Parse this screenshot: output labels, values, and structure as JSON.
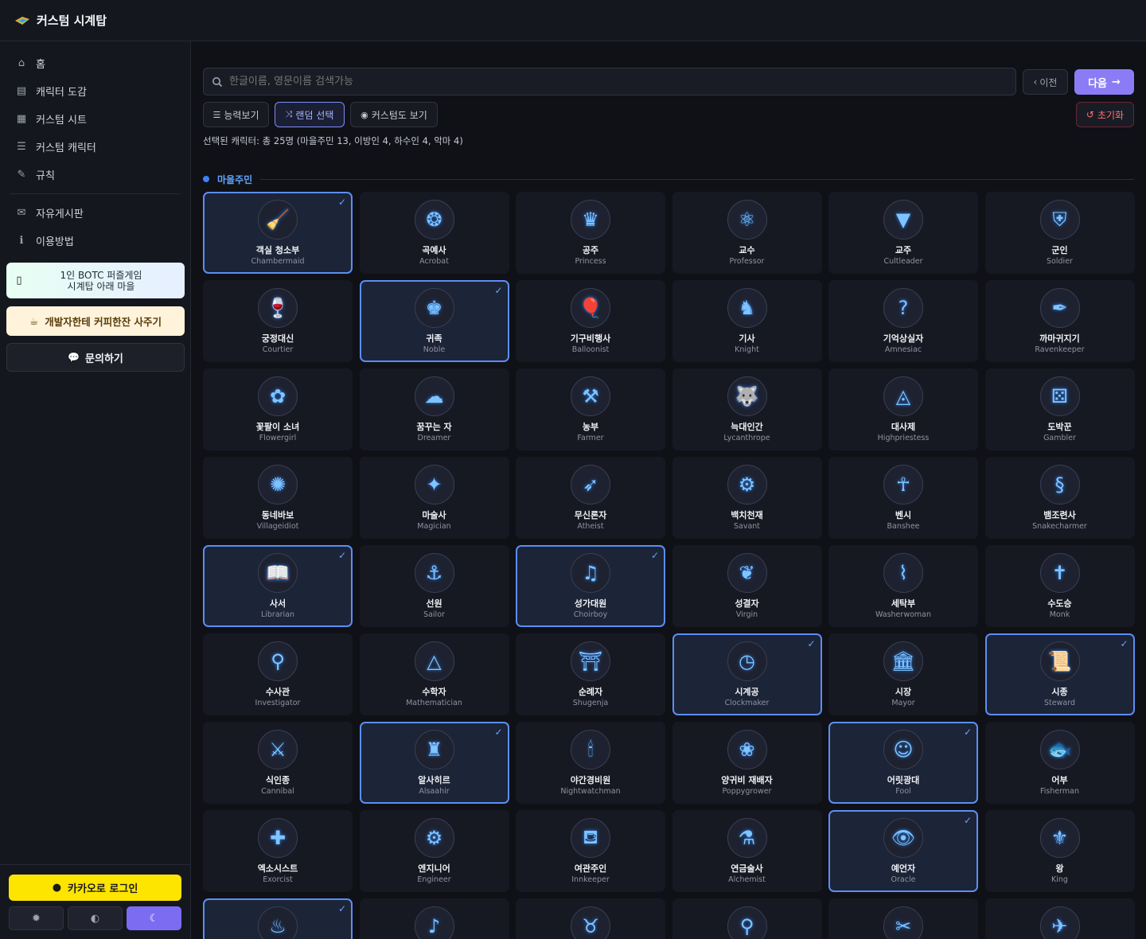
{
  "app": {
    "title": "커스텀 시계탑"
  },
  "nav": [
    {
      "label": "홈",
      "icon": "home-icon",
      "glyph": "⌂"
    },
    {
      "label": "캐릭터 도감",
      "icon": "book-icon",
      "glyph": "▤"
    },
    {
      "label": "커스텀 시트",
      "icon": "file-icon",
      "glyph": "▦"
    },
    {
      "label": "커스텀 캐릭터",
      "icon": "list-icon",
      "glyph": "☰"
    },
    {
      "label": "규칙",
      "icon": "scroll-icon",
      "glyph": "✎"
    }
  ],
  "nav2": [
    {
      "label": "자유게시판",
      "icon": "comments-icon",
      "glyph": "✉"
    },
    {
      "label": "이용방법",
      "icon": "info-icon",
      "glyph": "ℹ"
    }
  ],
  "promo": {
    "puzzle_line1": "1인 BOTC 퍼즐게임",
    "puzzle_line2": "시계탑 아래 마을",
    "coffee": "개발자한테 커피한잔 사주기",
    "inquiry": "문의하기"
  },
  "auth": {
    "kakao_login": "카카오로 로그인"
  },
  "toolbar": {
    "search_placeholder": "한글이름, 영문이름 검색가능",
    "prev": "이전",
    "next": "다음",
    "reset": "초기화",
    "ability_view": "능력보기",
    "random_select": "랜덤 선택",
    "view_custom": "커스텀도 보기"
  },
  "summary": "선택된 캐릭터: 총 25명 (마을주민 13, 이방인 4, 하수인 4, 악마 4)",
  "section": {
    "label": "마을주민"
  },
  "characters": [
    {
      "kr": "객실 청소부",
      "en": "Chambermaid",
      "selected": true,
      "glyph": "🧹"
    },
    {
      "kr": "곡예사",
      "en": "Acrobat",
      "selected": false,
      "glyph": "❂"
    },
    {
      "kr": "공주",
      "en": "Princess",
      "selected": false,
      "glyph": "♛"
    },
    {
      "kr": "교수",
      "en": "Professor",
      "selected": false,
      "glyph": "⚛"
    },
    {
      "kr": "교주",
      "en": "Cultleader",
      "selected": false,
      "glyph": "▼"
    },
    {
      "kr": "군인",
      "en": "Soldier",
      "selected": false,
      "glyph": "⛨"
    },
    {
      "kr": "궁정대신",
      "en": "Courtier",
      "selected": false,
      "glyph": "🍷"
    },
    {
      "kr": "귀족",
      "en": "Noble",
      "selected": true,
      "glyph": "♚"
    },
    {
      "kr": "기구비행사",
      "en": "Balloonist",
      "selected": false,
      "glyph": "🎈"
    },
    {
      "kr": "기사",
      "en": "Knight",
      "selected": false,
      "glyph": "♞"
    },
    {
      "kr": "기억상실자",
      "en": "Amnesiac",
      "selected": false,
      "glyph": "?"
    },
    {
      "kr": "까마귀지기",
      "en": "Ravenkeeper",
      "selected": false,
      "glyph": "✒"
    },
    {
      "kr": "꽃팔이 소녀",
      "en": "Flowergirl",
      "selected": false,
      "glyph": "✿"
    },
    {
      "kr": "꿈꾸는 자",
      "en": "Dreamer",
      "selected": false,
      "glyph": "☁"
    },
    {
      "kr": "농부",
      "en": "Farmer",
      "selected": false,
      "glyph": "⚒"
    },
    {
      "kr": "늑대인간",
      "en": "Lycanthrope",
      "selected": false,
      "glyph": "🐺"
    },
    {
      "kr": "대사제",
      "en": "Highpriestess",
      "selected": false,
      "glyph": "◬"
    },
    {
      "kr": "도박꾼",
      "en": "Gambler",
      "selected": false,
      "glyph": "⚄"
    },
    {
      "kr": "동네바보",
      "en": "Villageidiot",
      "selected": false,
      "glyph": "✺"
    },
    {
      "kr": "마술사",
      "en": "Magician",
      "selected": false,
      "glyph": "✦"
    },
    {
      "kr": "무신론자",
      "en": "Atheist",
      "selected": false,
      "glyph": "➶"
    },
    {
      "kr": "백치천재",
      "en": "Savant",
      "selected": false,
      "glyph": "⚙"
    },
    {
      "kr": "벤시",
      "en": "Banshee",
      "selected": false,
      "glyph": "☥"
    },
    {
      "kr": "뱀조련사",
      "en": "Snakecharmer",
      "selected": false,
      "glyph": "§"
    },
    {
      "kr": "사서",
      "en": "Librarian",
      "selected": true,
      "glyph": "📖"
    },
    {
      "kr": "선원",
      "en": "Sailor",
      "selected": false,
      "glyph": "⚓"
    },
    {
      "kr": "성가대원",
      "en": "Choirboy",
      "selected": true,
      "glyph": "♫"
    },
    {
      "kr": "성결자",
      "en": "Virgin",
      "selected": false,
      "glyph": "❦"
    },
    {
      "kr": "세탁부",
      "en": "Washerwoman",
      "selected": false,
      "glyph": "⌇"
    },
    {
      "kr": "수도승",
      "en": "Monk",
      "selected": false,
      "glyph": "✝"
    },
    {
      "kr": "수사관",
      "en": "Investigator",
      "selected": false,
      "glyph": "⚲"
    },
    {
      "kr": "수학자",
      "en": "Mathematician",
      "selected": false,
      "glyph": "△"
    },
    {
      "kr": "순례자",
      "en": "Shugenja",
      "selected": false,
      "glyph": "⛩"
    },
    {
      "kr": "시계공",
      "en": "Clockmaker",
      "selected": true,
      "glyph": "◷"
    },
    {
      "kr": "시장",
      "en": "Mayor",
      "selected": false,
      "glyph": "🏛"
    },
    {
      "kr": "시종",
      "en": "Steward",
      "selected": true,
      "glyph": "📜"
    },
    {
      "kr": "식인종",
      "en": "Cannibal",
      "selected": false,
      "glyph": "⚔"
    },
    {
      "kr": "알사히르",
      "en": "Alsaahir",
      "selected": true,
      "glyph": "♜"
    },
    {
      "kr": "야간경비원",
      "en": "Nightwatchman",
      "selected": false,
      "glyph": "🕯"
    },
    {
      "kr": "양귀비 재배자",
      "en": "Poppygrower",
      "selected": false,
      "glyph": "❀"
    },
    {
      "kr": "어릿광대",
      "en": "Fool",
      "selected": true,
      "glyph": "☺"
    },
    {
      "kr": "어부",
      "en": "Fisherman",
      "selected": false,
      "glyph": "🐟"
    },
    {
      "kr": "엑소시스트",
      "en": "Exorcist",
      "selected": false,
      "glyph": "✚"
    },
    {
      "kr": "엔지니어",
      "en": "Engineer",
      "selected": false,
      "glyph": "⚙"
    },
    {
      "kr": "여관주인",
      "en": "Innkeeper",
      "selected": false,
      "glyph": "⛾"
    },
    {
      "kr": "연금술사",
      "en": "Alchemist",
      "selected": false,
      "glyph": "⚗"
    },
    {
      "kr": "예언자",
      "en": "Oracle",
      "selected": true,
      "glyph": "👁"
    },
    {
      "kr": "왕",
      "en": "King",
      "selected": false,
      "glyph": "⚜"
    },
    {
      "kr": "",
      "en": "",
      "selected": true,
      "glyph": "♨"
    },
    {
      "kr": "",
      "en": "",
      "selected": false,
      "glyph": "♪"
    },
    {
      "kr": "",
      "en": "",
      "selected": false,
      "glyph": "♉"
    },
    {
      "kr": "",
      "en": "",
      "selected": false,
      "glyph": "⚲"
    },
    {
      "kr": "",
      "en": "",
      "selected": false,
      "glyph": "✂"
    },
    {
      "kr": "",
      "en": "",
      "selected": false,
      "glyph": "✈"
    }
  ],
  "colors": {
    "accent": "#8b7cf6",
    "selected_border": "#5b8ef5",
    "kakao": "#fee500",
    "danger": "#f87171"
  }
}
